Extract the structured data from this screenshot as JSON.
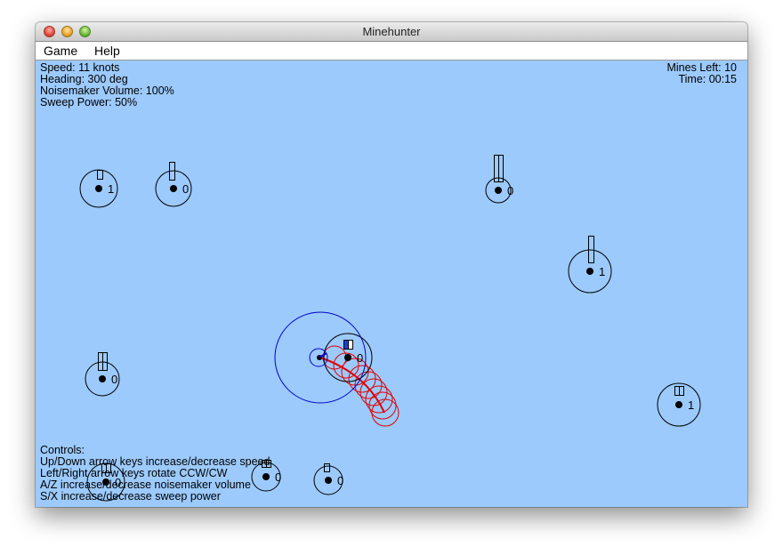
{
  "window": {
    "title": "Minehunter"
  },
  "menu": {
    "items": [
      {
        "label": "Game"
      },
      {
        "label": "Help"
      }
    ]
  },
  "hud": {
    "speed": "Speed: 11 knots",
    "heading": "Heading: 300 deg",
    "noisemaker": "Noisemaker Volume: 100%",
    "sweep": "Sweep Power: 50%",
    "mines_left": "Mines Left: 10",
    "time": "Time: 00:15"
  },
  "controls": {
    "title": "Controls:",
    "lines": [
      "Up/Down arrow keys increase/decrease speed",
      "Left/Right arrow keys rotate CCW/CW",
      "A/Z increase/decrease noisemaker volume",
      "S/X increase/decrease sweep power"
    ]
  },
  "mines": [
    {
      "label": "1"
    },
    {
      "label": "0"
    },
    {
      "label": "0"
    },
    {
      "label": "1"
    },
    {
      "label": "0"
    },
    {
      "label": "0"
    },
    {
      "label": "1"
    },
    {
      "label": "0"
    },
    {
      "label": "0"
    },
    {
      "label": "0"
    }
  ],
  "colors": {
    "sea": "#9ccafc",
    "ship": "#0000cc",
    "wake": "#e00000",
    "mine": "#000000",
    "gauge_fill": "#1a3fd8"
  }
}
